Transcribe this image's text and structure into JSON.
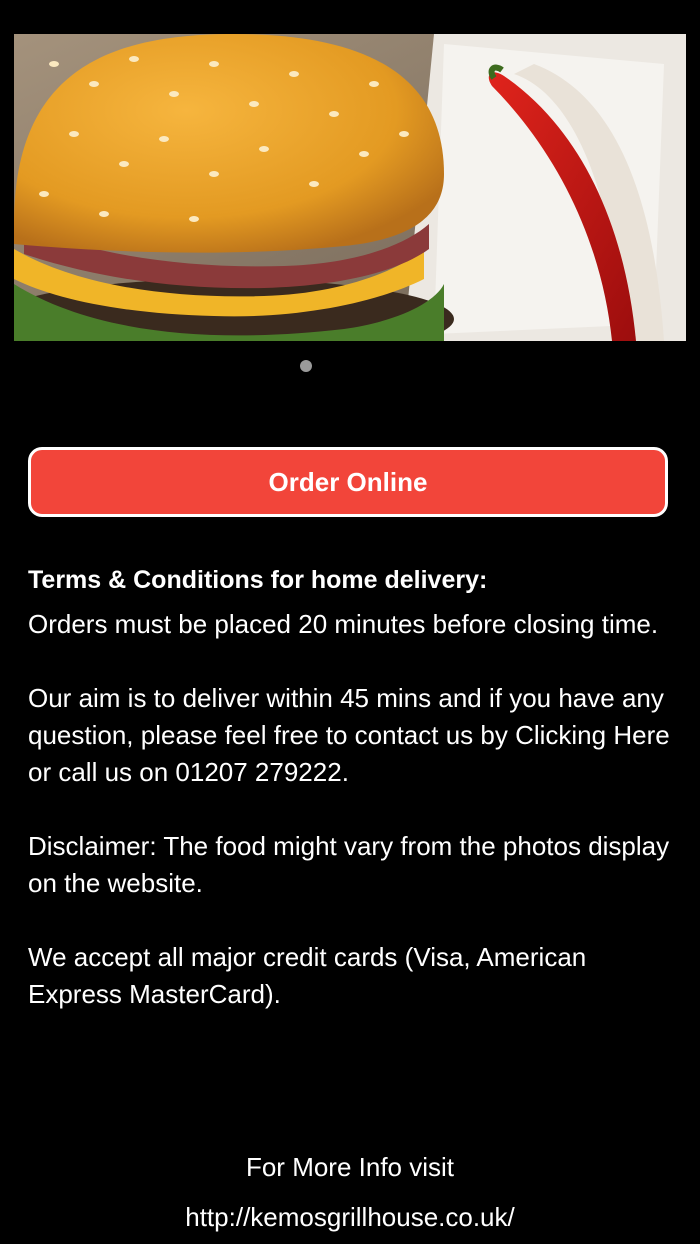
{
  "carousel": {
    "image_alt": "burger with red chili pepper",
    "slide_count": 1,
    "active_index": 0
  },
  "order_button": {
    "label": "Order Online"
  },
  "terms": {
    "heading": "Terms & Conditions for home delivery:",
    "paragraphs": [
      "Orders must be placed 20 minutes before closing time.",
      "Our aim is to deliver within 45 mins and if you have any question, please feel free to contact us by Clicking Here or call us on 01207 279222.",
      "Disclaimer: The food might vary from the photos display on the website.",
      "We accept all major credit cards (Visa, American Express MasterCard)."
    ]
  },
  "footer": {
    "info_text": "For More Info visit",
    "url": "http://kemosgrillhouse.co.uk/"
  },
  "colors": {
    "background": "#000000",
    "button": "#f2453a",
    "text": "#ffffff",
    "dot": "#9a9a9a"
  }
}
